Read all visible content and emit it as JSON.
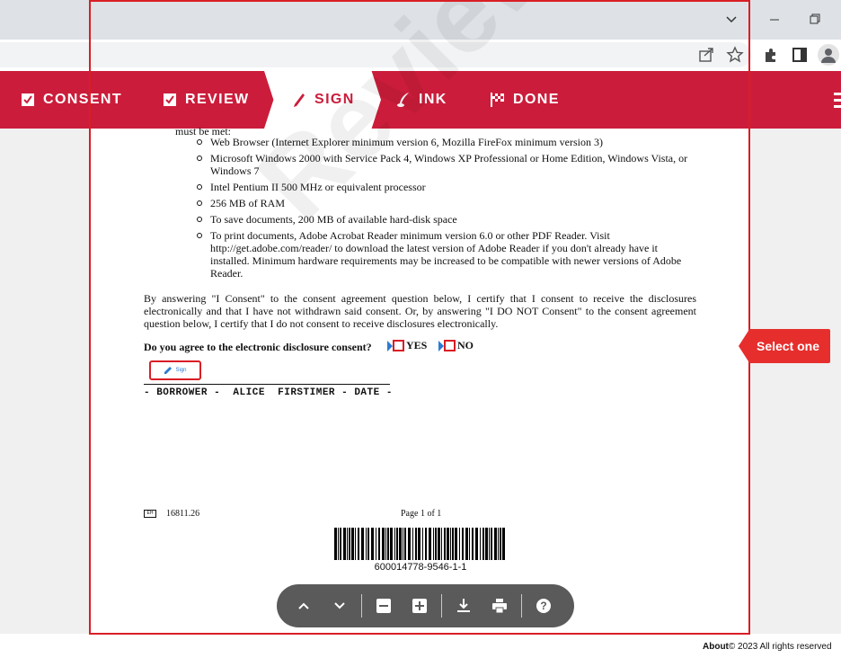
{
  "browser": {
    "icons": [
      "chevron-down-icon",
      "minimize-icon",
      "restore-icon",
      "share-icon",
      "star-icon",
      "extensions-icon",
      "side-panel-icon",
      "profile-icon"
    ]
  },
  "steps": {
    "consent": "CONSENT",
    "review": "REVIEW",
    "sign": "SIGN",
    "ink": "INK",
    "done": "DONE",
    "active": "SIGN",
    "accent": "#cb1d3b"
  },
  "document": {
    "must_be_met": "must be met:",
    "requirements": [
      "Web Browser (Internet Explorer minimum version 6, Mozilla FireFox minimum version 3)",
      "Microsoft Windows 2000 with Service Pack 4, Windows XP Professional or Home Edition, Windows Vista, or Windows 7",
      "Intel Pentium II 500 MHz or equivalent processor",
      "256 MB of RAM",
      "To save documents, 200 MB of available hard-disk space",
      "To print documents, Adobe Acrobat Reader minimum version 6.0 or other PDF Reader. Visit http://get.adobe.com/reader/ to download the latest version of Adobe Reader if you don't already have it installed. Minimum hardware requirements may be increased to be compatible with newer versions of Adobe Reader."
    ],
    "consent_paragraph": "By answering \"I Consent\" to the consent agreement question below, I certify that I consent to receive the disclosures electronically and that I have not withdrawn said consent. Or, by answering \"I DO NOT Consent\" to the consent agreement question below, I certify that I do not consent to receive disclosures electronically.",
    "question": "Do you agree to the electronic disclosure consent?",
    "yes_label": "YES",
    "no_label": "NO",
    "sign_button": "Sign",
    "borrower_line": "- BORROWER -  ALICE  FIRSTIMER - DATE -",
    "footer_mark": "EH",
    "footer_code": "16811.26",
    "footer_page": "Page 1 of 1",
    "barcode_number": "600014778-9546-1-1",
    "watermark": "Review"
  },
  "toolbar": {
    "icons": [
      "chevron-up-icon",
      "chevron-down-icon",
      "zoom-out-icon",
      "zoom-in-icon",
      "download-icon",
      "print-icon",
      "help-icon"
    ]
  },
  "callout": "Select one",
  "footer": {
    "about": "About",
    "copyright": "© 2023 All rights reserved"
  }
}
